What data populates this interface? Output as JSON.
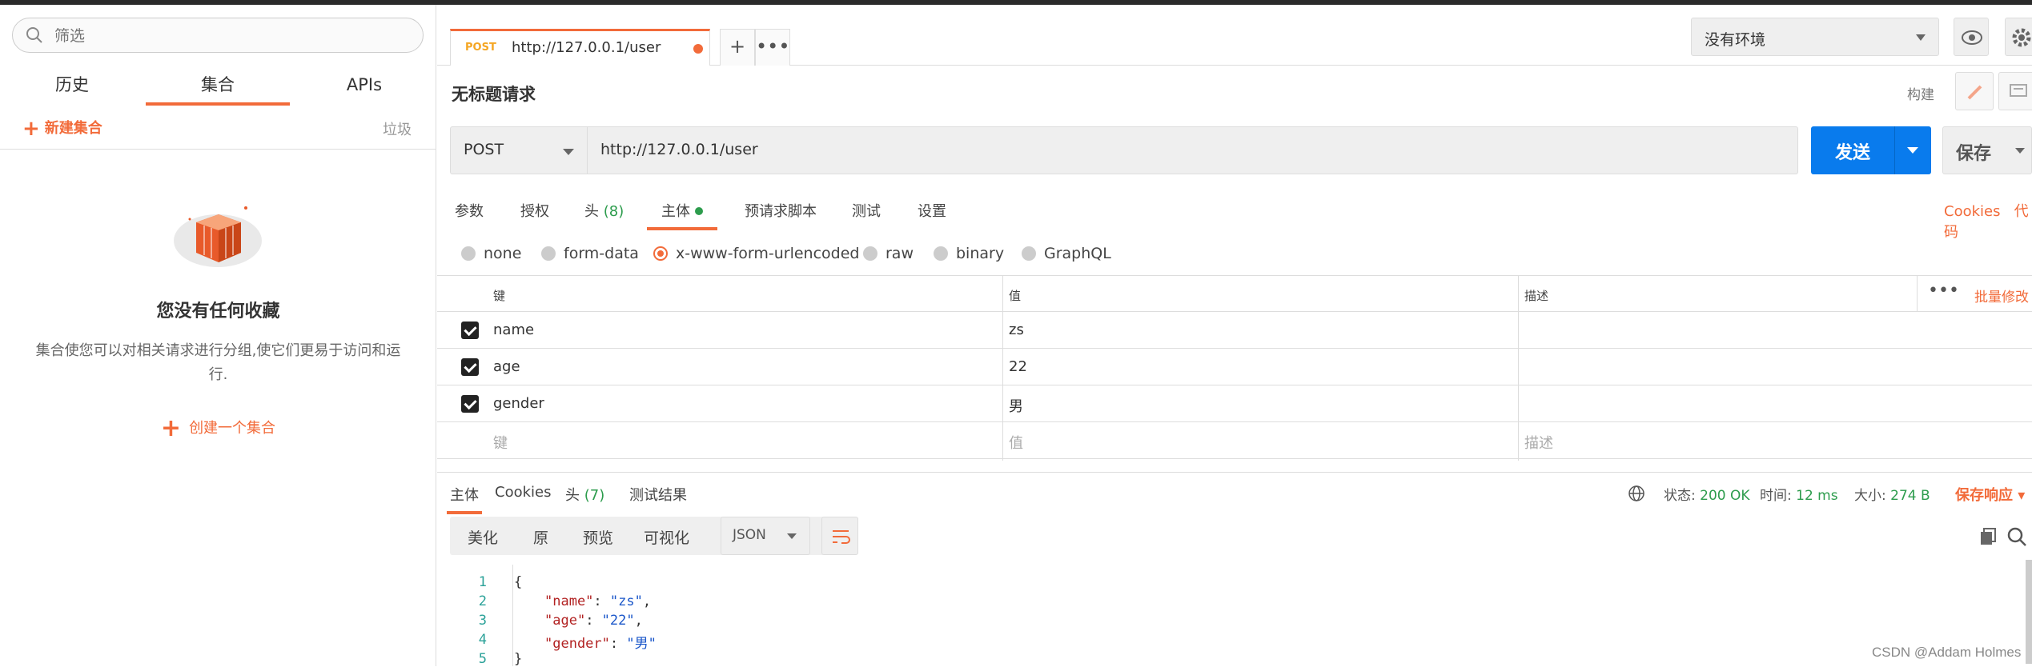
{
  "sidebar": {
    "search_placeholder": "筛选",
    "tabs": [
      "历史",
      "集合",
      "APIs"
    ],
    "new_collection": "新建集合",
    "trash": "垃圾",
    "empty_title": "您没有任何收藏",
    "empty_desc": "集合使您可以对相关请求进行分组,使它们更易于访问和运行.",
    "create_collection": "创建一个集合"
  },
  "request_tab": {
    "method": "POST",
    "url": "http://127.0.0.1/user"
  },
  "environment": "没有环境",
  "request": {
    "title": "无标题请求",
    "build": "构建",
    "method": "POST",
    "url": "http://127.0.0.1/user",
    "send": "发送",
    "save": "保存"
  },
  "req_tabs": {
    "params": "参数",
    "auth": "授权",
    "headers": "头",
    "headers_count": "(8)",
    "body": "主体",
    "prerequest": "预请求脚本",
    "tests": "测试",
    "settings": "设置",
    "cookies": "Cookies",
    "code": "代码"
  },
  "body_types": [
    "none",
    "form-data",
    "x-www-form-urlencoded",
    "raw",
    "binary",
    "GraphQL"
  ],
  "table": {
    "headers": {
      "key": "键",
      "value": "值",
      "desc": "描述"
    },
    "bulk_edit": "批量修改",
    "rows": [
      {
        "key": "name",
        "value": "zs",
        "desc": ""
      },
      {
        "key": "age",
        "value": "22",
        "desc": ""
      },
      {
        "key": "gender",
        "value": "男",
        "desc": ""
      }
    ],
    "placeholder": {
      "key": "键",
      "value": "值",
      "desc": "描述"
    }
  },
  "response": {
    "tabs": {
      "body": "主体",
      "cookies": "Cookies",
      "headers": "头",
      "headers_count": "(7)",
      "tests": "测试结果"
    },
    "status_label": "状态:",
    "status": "200 OK",
    "time_label": "时间:",
    "time": "12 ms",
    "size_label": "大小:",
    "size": "274 B",
    "save_response": "保存响应",
    "view_modes": [
      "美化",
      "原",
      "预览",
      "可视化"
    ],
    "format": "JSON",
    "code_lines": [
      {
        "n": "1",
        "text": "{"
      },
      {
        "n": "2",
        "key": "\"name\"",
        "val": "\"zs\""
      },
      {
        "n": "3",
        "key": "\"age\"",
        "val": "\"22\""
      },
      {
        "n": "4",
        "key": "\"gender\"",
        "val": "\"男\""
      },
      {
        "n": "5",
        "text": "}"
      }
    ]
  },
  "watermark": "CSDN @Addam Holmes"
}
